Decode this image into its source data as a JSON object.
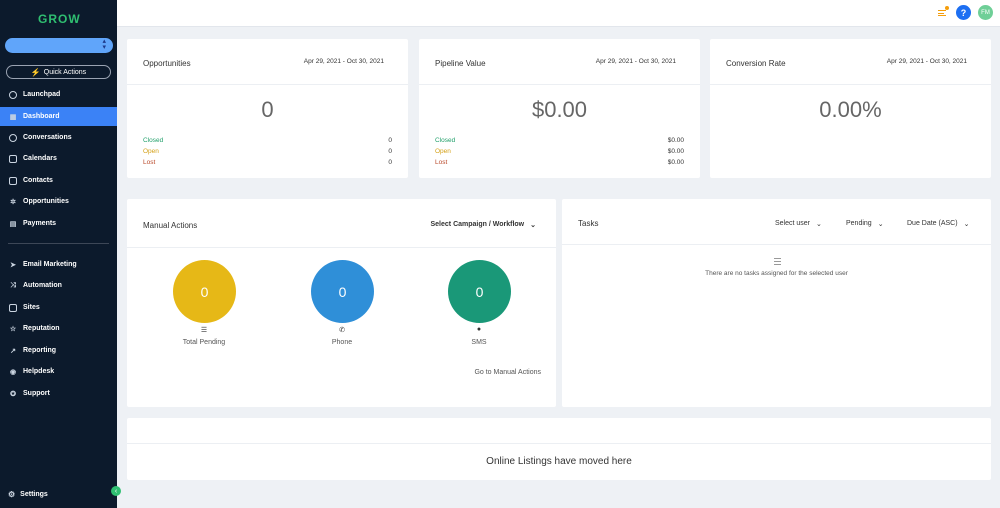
{
  "sidebar": {
    "logo": "GROW",
    "quick_actions": "Quick Actions",
    "items": [
      {
        "label": "Launchpad",
        "icon": "launchpad-icon"
      },
      {
        "label": "Dashboard",
        "icon": "dashboard-icon",
        "active": true
      },
      {
        "label": "Conversations",
        "icon": "chat-icon"
      },
      {
        "label": "Calendars",
        "icon": "calendar-icon"
      },
      {
        "label": "Contacts",
        "icon": "contacts-icon"
      },
      {
        "label": "Opportunities",
        "icon": "opportunities-icon"
      },
      {
        "label": "Payments",
        "icon": "payments-icon"
      },
      {
        "label": "Email Marketing",
        "icon": "send-icon"
      },
      {
        "label": "Automation",
        "icon": "automation-icon"
      },
      {
        "label": "Sites",
        "icon": "sites-icon"
      },
      {
        "label": "Reputation",
        "icon": "star-icon"
      },
      {
        "label": "Reporting",
        "icon": "trend-icon"
      },
      {
        "label": "Helpdesk",
        "icon": "helpdesk-icon"
      },
      {
        "label": "Support",
        "icon": "support-icon"
      }
    ],
    "settings": "Settings"
  },
  "topbar": {
    "help": "?",
    "avatar_initials": "FM"
  },
  "opportunities": {
    "title": "Opportunities",
    "date_range": "Apr 29, 2021 - Oct 30, 2021",
    "value": "0",
    "rows": [
      {
        "label": "Closed",
        "value": "0"
      },
      {
        "label": "Open",
        "value": "0"
      },
      {
        "label": "Lost",
        "value": "0"
      }
    ]
  },
  "pipeline": {
    "title": "Pipeline Value",
    "date_range": "Apr 29, 2021 - Oct 30, 2021",
    "value": "$0.00",
    "rows": [
      {
        "label": "Closed",
        "value": "$0.00"
      },
      {
        "label": "Open",
        "value": "$0.00"
      },
      {
        "label": "Lost",
        "value": "$0.00"
      }
    ]
  },
  "conversion": {
    "title": "Conversion Rate",
    "date_range": "Apr 29, 2021 - Oct 30, 2021",
    "value": "0.00%"
  },
  "manual_actions": {
    "title": "Manual Actions",
    "select_label": "Select Campaign / Workflow",
    "circles": [
      {
        "value": "0",
        "label": "Total Pending",
        "color": "#e6b817"
      },
      {
        "value": "0",
        "label": "Phone",
        "color": "#2f8fd8"
      },
      {
        "value": "0",
        "label": "SMS",
        "color": "#1a9878"
      }
    ],
    "link": "Go to Manual Actions"
  },
  "tasks": {
    "title": "Tasks",
    "filters": [
      "Select user",
      "Pending",
      "Due Date (ASC)"
    ],
    "empty": "There are no tasks assigned for the selected user"
  },
  "listings": {
    "text": "Online Listings have moved here"
  },
  "colors": {
    "sidebar_bg": "#0c1a2c",
    "active": "#3b82f6",
    "brand_green": "#2fbf71"
  }
}
